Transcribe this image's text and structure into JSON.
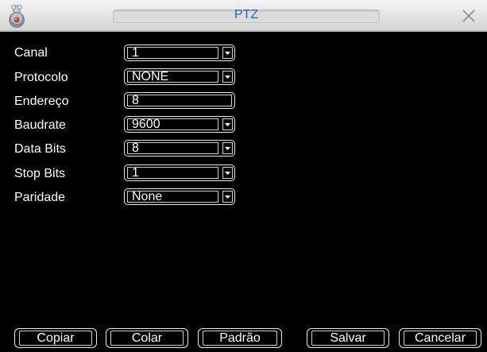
{
  "window": {
    "title": "PTZ",
    "app_icon": "ptz-camera-icon",
    "close_icon": "close-icon"
  },
  "fields": [
    {
      "label": "Canal",
      "value": "1",
      "type": "select"
    },
    {
      "label": "Protocolo",
      "value": "NONE",
      "type": "select"
    },
    {
      "label": "Endereço",
      "value": "8",
      "type": "text"
    },
    {
      "label": "Baudrate",
      "value": "9600",
      "type": "select"
    },
    {
      "label": "Data Bits",
      "value": "8",
      "type": "select"
    },
    {
      "label": "Stop Bits",
      "value": "1",
      "type": "select"
    },
    {
      "label": "Paridade",
      "value": "None",
      "type": "select"
    }
  ],
  "buttons": {
    "copy": "Copiar",
    "paste": "Colar",
    "default": "Padrão",
    "save": "Salvar",
    "cancel": "Cancelar"
  },
  "colors": {
    "background": "#000000",
    "title_text": "#2d63ad",
    "text": "#ffffff",
    "titlebar": "#e2e2e2"
  }
}
